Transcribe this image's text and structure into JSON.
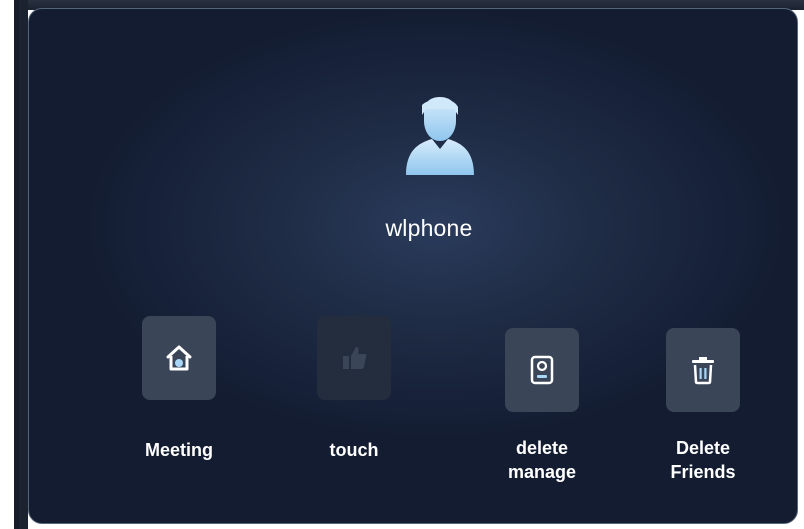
{
  "contact": {
    "name": "wlphone",
    "avatar_icon": "user-silhouette-icon"
  },
  "actions": [
    {
      "id": "meeting",
      "label": "Meeting",
      "icon": "home-icon",
      "enabled": true
    },
    {
      "id": "touch",
      "label": "touch",
      "icon": "thumbs-up-icon",
      "enabled": false
    },
    {
      "id": "manage",
      "label": "delete\nmanage",
      "icon": "door-phone-icon",
      "enabled": true
    },
    {
      "id": "delete",
      "label": "Delete\nFriends",
      "icon": "trash-icon",
      "enabled": true
    }
  ],
  "colors": {
    "panel_background": "#1b2740",
    "button_background": "#3a4557",
    "icon_accent": "#a9d6f5",
    "text": "#ffffff"
  }
}
